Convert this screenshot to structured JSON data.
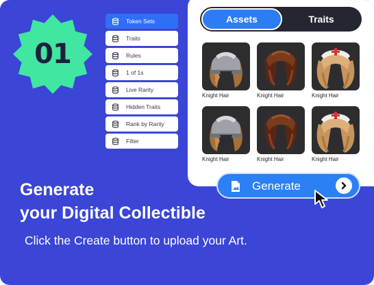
{
  "badge": {
    "number": "01",
    "color": "#41e6a0"
  },
  "menu": {
    "items": [
      {
        "label": "Token Sets",
        "active": true
      },
      {
        "label": "Traits"
      },
      {
        "label": "Rules"
      },
      {
        "label": "1 of 1s"
      },
      {
        "label": "Live Rarity"
      },
      {
        "label": "Hidden Traits"
      },
      {
        "label": "Rank by Rarity"
      },
      {
        "label": "Filter"
      }
    ],
    "icon": "database-icon",
    "accent": "#2f6ff5"
  },
  "panel": {
    "tabs": [
      {
        "label": "Assets",
        "active": true
      },
      {
        "label": "Traits"
      }
    ],
    "assets": [
      {
        "label": "Knight Hair",
        "variant": "helmet"
      },
      {
        "label": "Knight Hair",
        "variant": "dark"
      },
      {
        "label": "Knight Hair",
        "variant": "bandana"
      },
      {
        "label": "Knight Hair",
        "variant": "helmet"
      },
      {
        "label": "Knight Hair",
        "variant": "dark"
      },
      {
        "label": "Knight Hair",
        "variant": "bandana"
      }
    ]
  },
  "generate": {
    "label": "Generate",
    "icon": "file-icon",
    "arrow_icon": "chevron-right-icon"
  },
  "headline": {
    "line1": "Generate",
    "line2": "your Digital Collectible"
  },
  "subtitle": "Click the Create button to upload your Art.",
  "colors": {
    "background": "#3b45d6",
    "button": "#2b80f4",
    "dark": "#242631"
  }
}
